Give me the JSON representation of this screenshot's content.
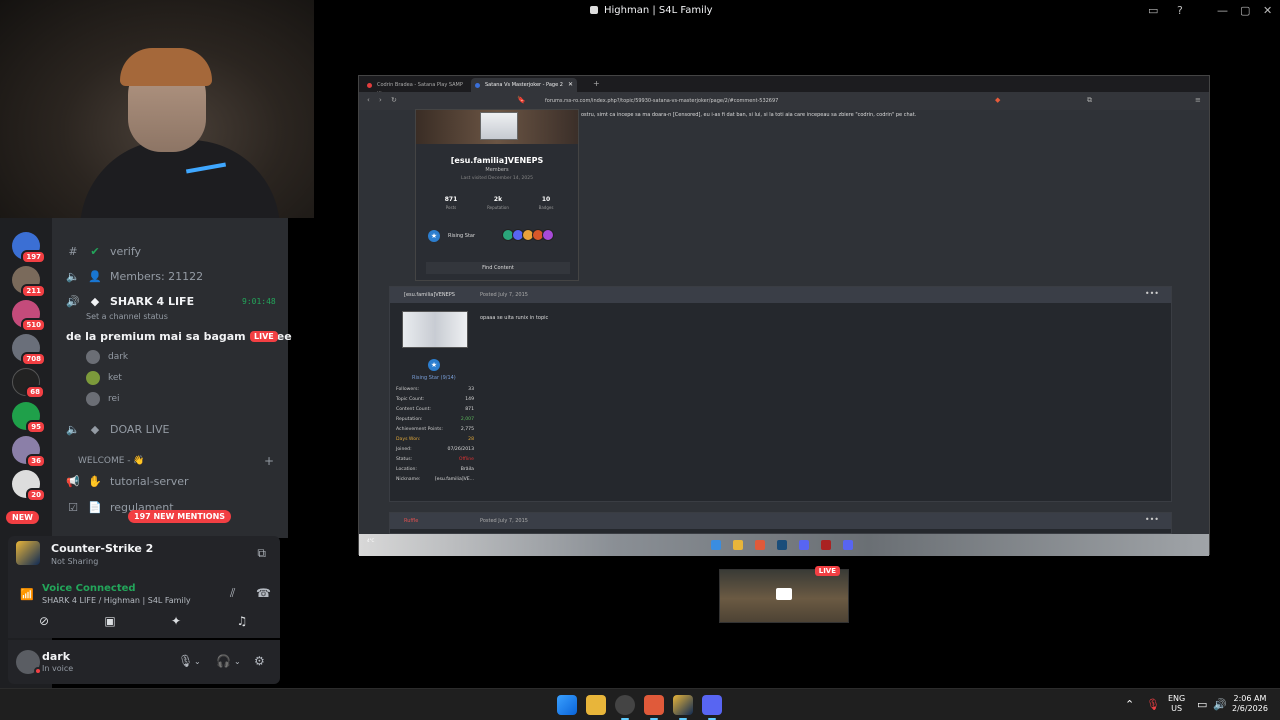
{
  "stream": {
    "title": "Highman | S4L Family"
  },
  "discord": {
    "servers": [
      {
        "badge": "197",
        "color": "#3b6fd4"
      },
      {
        "badge": "211",
        "color": "#7a6a5b"
      },
      {
        "badge": "510",
        "color": "#c44b7b"
      },
      {
        "badge": "708",
        "color": "#6a6f7a"
      },
      {
        "badge": "68",
        "color": "#222"
      },
      {
        "badge": "95",
        "color": "#1fa04a"
      },
      {
        "badge": "36",
        "color": "#8b7fa8"
      },
      {
        "badge": "20",
        "color": "#ddd"
      }
    ],
    "new_label": "NEW",
    "channels": {
      "verify": "verify",
      "members": "Members: 21122",
      "active": "SHARK 4 LIFE",
      "active_time": "9:01:48",
      "status_placeholder": "Set a channel status",
      "voice_users": [
        "dark",
        "ket",
        "rei"
      ],
      "doar_live": "DOAR LIVE",
      "category": "WELCOME - 👋",
      "tutorial": "tutorial-server",
      "regulament": "regulament",
      "mentions": "197 NEW MENTIONS"
    },
    "chat_overlay": "de la premium mai sa bagam un hee",
    "live_label": "LIVE",
    "game": {
      "title": "Counter-Strike 2",
      "sub": "Not Sharing"
    },
    "voice": {
      "status": "Voice Connected",
      "channel": "SHARK 4 LIFE / Highman | S4L Family"
    },
    "user": {
      "name": "dark",
      "status": "In voice"
    }
  },
  "browser": {
    "tabs": [
      {
        "label": "Codrin Bradea - Satana Play SAMP ..."
      },
      {
        "label": "Satana Vs Masterjoker - Page 2"
      }
    ],
    "url": "forums.rss-ro.com/index.php?/topic/59930-satana-vs-masterjoker/page/2/#comment-532697",
    "top_text": "ostru, simt ca incepe sa ma doara-n [Censored], eu i-as fi dat ban, si lui, si la toti aia care incepeau sa zbiere \"codrin, codrin\" pe chat.",
    "hovercard": {
      "name": "[esu.familia]VENEPS",
      "group": "Members",
      "last_visit": "Last visited December 14, 2025",
      "posts_n": "871",
      "posts_l": "Posts",
      "rep_n": "2k",
      "rep_l": "Reputation",
      "badges_n": "10",
      "badges_l": "Badges",
      "rank": "Rising Star",
      "find": "Find Content"
    },
    "post": {
      "author": "[esu.familia]VENEPS",
      "date": "Posted July 7, 2015",
      "text": "opaaa se uita runix in topic",
      "rank": "Rising Star (9/14)",
      "stats": [
        {
          "label": "Followers:",
          "value": "33"
        },
        {
          "label": "Topic Count:",
          "value": "149"
        },
        {
          "label": "Content Count:",
          "value": "871"
        },
        {
          "label": "Reputation:",
          "value": "2,007"
        },
        {
          "label": "Achievement Points:",
          "value": "2,775"
        },
        {
          "label": "Days Won:",
          "value": "28"
        },
        {
          "label": "Joined:",
          "value": "07/26/2013"
        },
        {
          "label": "Status:",
          "value": "Offline"
        },
        {
          "label": "Location:",
          "value": "Brăila"
        },
        {
          "label": "Nickname:",
          "value": "[esu.familia]VE..."
        }
      ]
    },
    "next_post": {
      "author": "Ruffle",
      "date": "Posted July 7, 2015"
    },
    "taskbar_weather": "4°C"
  },
  "preview": {
    "live": "LIVE"
  },
  "taskbar": {
    "lang_top": "ENG",
    "lang_bottom": "US",
    "time": "2:06 AM",
    "date": "2/6/2026"
  }
}
